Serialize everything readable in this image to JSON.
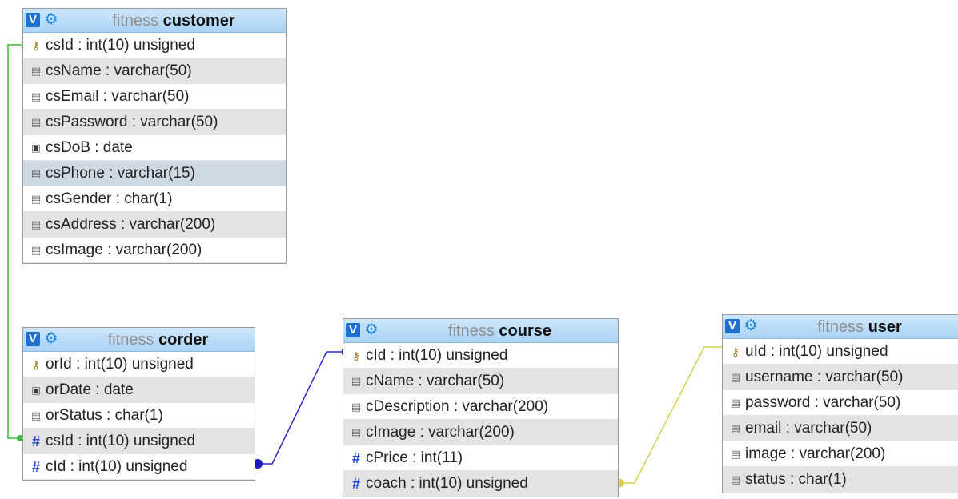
{
  "tables": {
    "customer": {
      "db": "fitness",
      "name": "customer",
      "columns": [
        {
          "text": "csId : int(10) unsigned",
          "icon": "primary-key-icon"
        },
        {
          "text": "csName : varchar(50)",
          "icon": "column-icon"
        },
        {
          "text": "csEmail : varchar(50)",
          "icon": "column-icon"
        },
        {
          "text": "csPassword : varchar(50)",
          "icon": "column-icon"
        },
        {
          "text": "csDoB : date",
          "icon": "date-column-icon"
        },
        {
          "text": "csPhone : varchar(15)",
          "icon": "column-icon"
        },
        {
          "text": "csGender : char(1)",
          "icon": "column-icon"
        },
        {
          "text": "csAddress : varchar(200)",
          "icon": "column-icon"
        },
        {
          "text": "csImage : varchar(200)",
          "icon": "column-icon"
        }
      ]
    },
    "corder": {
      "db": "fitness",
      "name": "corder",
      "columns": [
        {
          "text": "orId : int(10) unsigned",
          "icon": "primary-key-icon"
        },
        {
          "text": "orDate : date",
          "icon": "date-column-icon"
        },
        {
          "text": "orStatus : char(1)",
          "icon": "column-icon"
        },
        {
          "text": "csId : int(10) unsigned",
          "icon": "numeric-column-icon"
        },
        {
          "text": "cId : int(10) unsigned",
          "icon": "numeric-column-icon"
        }
      ]
    },
    "course": {
      "db": "fitness",
      "name": "course",
      "columns": [
        {
          "text": "cId : int(10) unsigned",
          "icon": "primary-key-icon"
        },
        {
          "text": "cName : varchar(50)",
          "icon": "column-icon"
        },
        {
          "text": "cDescription : varchar(200)",
          "icon": "column-icon"
        },
        {
          "text": "cImage : varchar(200)",
          "icon": "column-icon"
        },
        {
          "text": "cPrice : int(11)",
          "icon": "numeric-column-icon"
        },
        {
          "text": "coach : int(10) unsigned",
          "icon": "numeric-column-icon"
        }
      ]
    },
    "user": {
      "db": "fitness",
      "name": "user",
      "columns": [
        {
          "text": "uId : int(10) unsigned",
          "icon": "primary-key-icon"
        },
        {
          "text": "username : varchar(50)",
          "icon": "column-icon"
        },
        {
          "text": "password : varchar(50)",
          "icon": "column-icon"
        },
        {
          "text": "email : varchar(50)",
          "icon": "column-icon"
        },
        {
          "text": "image : varchar(200)",
          "icon": "column-icon"
        },
        {
          "text": "status : char(1)",
          "icon": "column-icon"
        }
      ]
    }
  },
  "header_toggle_label": "V",
  "relations": [
    {
      "from": "corder.csId",
      "to": "customer.csId",
      "color": "#3cb83c"
    },
    {
      "from": "corder.cId",
      "to": "course.cId",
      "color": "#2a2ac8"
    },
    {
      "from": "course.coach",
      "to": "user.uId",
      "color": "#d8d04a"
    }
  ],
  "colors": {
    "header_gradient_top": "#cfe6fb",
    "header_gradient_bottom": "#a9d3f6",
    "toggle_button": "#1f6fd1",
    "gear_icon": "#1a86e0",
    "alt_row": "#e3e3e3",
    "selected_row": "#cfd9e4"
  }
}
